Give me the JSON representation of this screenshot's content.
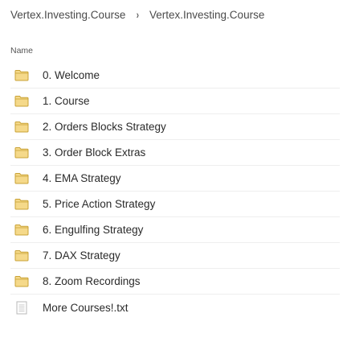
{
  "breadcrumb": {
    "items": [
      "Vertex.Investing.Course",
      "Vertex.Investing.Course"
    ],
    "separator": "›"
  },
  "column_header": "Name",
  "colors": {
    "folder_fill": "#f5d98a",
    "folder_stroke": "#c9a236",
    "file_stroke": "#b8b8b8"
  },
  "items": [
    {
      "name": "0. Welcome",
      "icon": "folder-icon"
    },
    {
      "name": "1. Course",
      "icon": "folder-icon"
    },
    {
      "name": "2. Orders Blocks Strategy",
      "icon": "folder-icon"
    },
    {
      "name": "3. Order Block Extras",
      "icon": "folder-icon"
    },
    {
      "name": "4. EMA Strategy",
      "icon": "folder-icon"
    },
    {
      "name": "5. Price Action Strategy",
      "icon": "folder-icon"
    },
    {
      "name": "6. Engulfing Strategy",
      "icon": "folder-icon"
    },
    {
      "name": "7. DAX Strategy",
      "icon": "folder-icon"
    },
    {
      "name": "8. Zoom Recordings",
      "icon": "folder-icon"
    },
    {
      "name": "More Courses!.txt",
      "icon": "text-file-icon"
    }
  ]
}
